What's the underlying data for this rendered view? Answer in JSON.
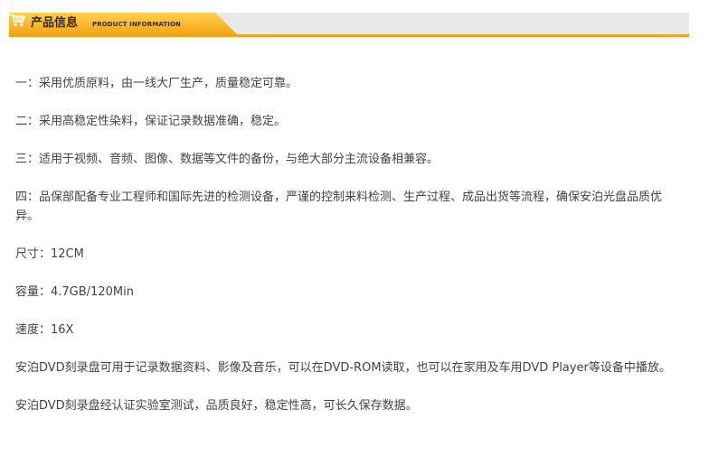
{
  "header": {
    "title_cn": "产品信息",
    "title_en": "PRODUCT INFORMATION",
    "icon": "cart-icon",
    "accent_color": "#f5a316"
  },
  "paragraphs": [
    "一：采用优质原料，由一线大厂生产，质量稳定可靠。",
    "二：采用高稳定性染料，保证记录数据准确，稳定。",
    "三：适用于视频、音频、图像、数据等文件的备份，与绝大部分主流设备相兼容。",
    "四：品保部配备专业工程师和国际先进的检测设备，严谨的控制来料检测、生产过程、成品出货等流程，确保安泊光盘品质优异。",
    "尺寸：12CM",
    "容量：4.7GB/120Min",
    "速度：16X",
    "安泊DVD刻录盘可用于记录数据资料、影像及音乐，可以在DVD-ROM读取，也可以在家用及车用DVD Player等设备中播放。",
    "安泊DVD刻录盘经认证实验室测试，品质良好，稳定性高，可长久保存数据。"
  ]
}
